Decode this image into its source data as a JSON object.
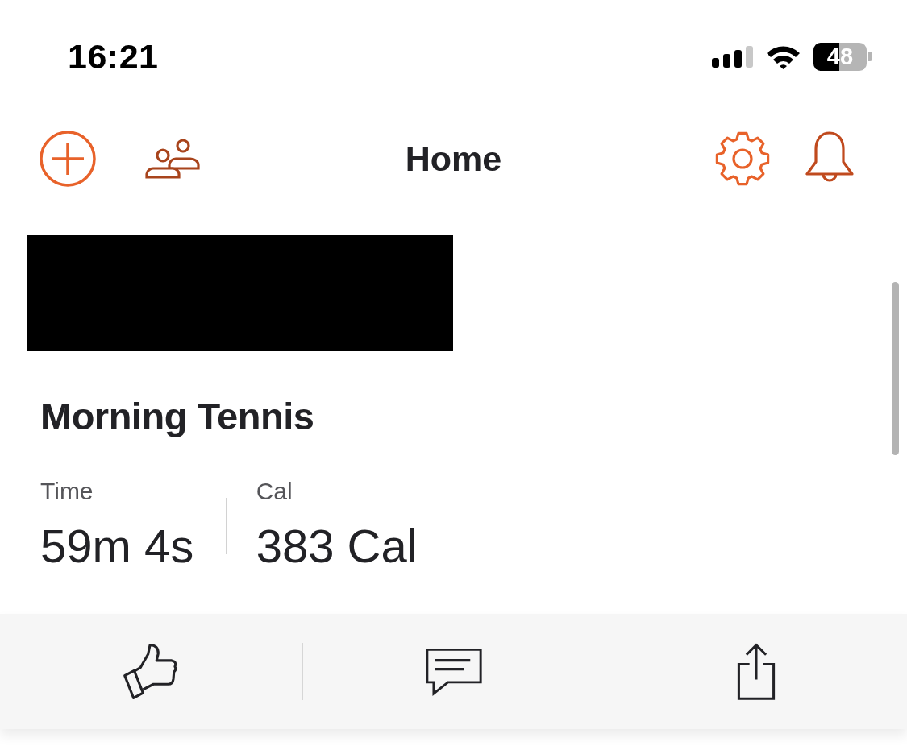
{
  "status_bar": {
    "time": "16:21",
    "battery": "48"
  },
  "nav_bar": {
    "title": "Home"
  },
  "activity": {
    "title": "Morning Tennis",
    "stats": [
      {
        "label": "Time",
        "value": "59m 4s"
      },
      {
        "label": "Cal",
        "value": "383 Cal"
      }
    ]
  }
}
